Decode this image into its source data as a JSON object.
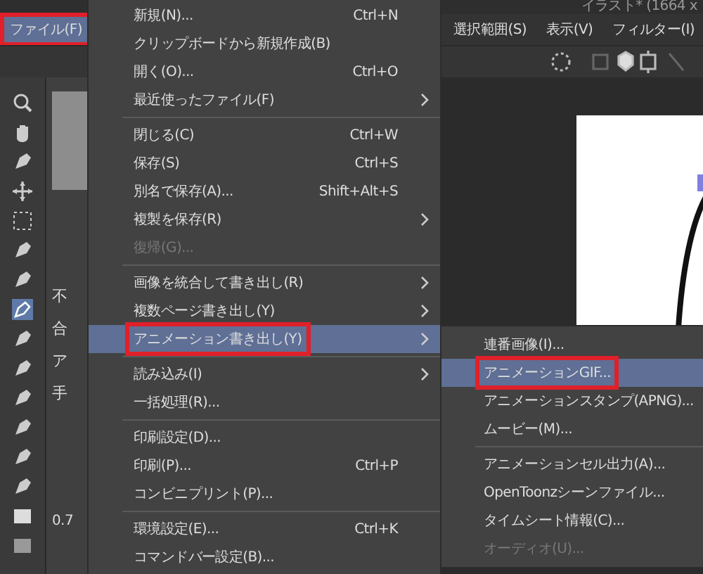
{
  "title": "イラスト* (1664 x",
  "menubar": [
    {
      "label": "ファイル(F)",
      "selected": true,
      "marked": true
    },
    {
      "label": "選択範囲(S)",
      "selected": false,
      "marked": false
    },
    {
      "label": "表示(V)",
      "selected": false,
      "marked": false
    },
    {
      "label": "フィルター(I)",
      "selected": false,
      "marked": false
    }
  ],
  "file_menu": [
    {
      "kind": "item",
      "label": "新規(N)...",
      "shortcut": "Ctrl+N",
      "submenu": false,
      "disabled": false,
      "selected": false,
      "marked": false
    },
    {
      "kind": "item",
      "label": "クリップボードから新規作成(B)",
      "submenu": false,
      "disabled": false,
      "selected": false,
      "marked": false
    },
    {
      "kind": "item",
      "label": "開く(O)...",
      "shortcut": "Ctrl+O",
      "submenu": false,
      "disabled": false,
      "selected": false,
      "marked": false
    },
    {
      "kind": "item",
      "label": "最近使ったファイル(F)",
      "submenu": true,
      "disabled": false,
      "selected": false,
      "marked": false
    },
    {
      "kind": "separator"
    },
    {
      "kind": "item",
      "label": "閉じる(C)",
      "shortcut": "Ctrl+W",
      "submenu": false,
      "disabled": false,
      "selected": false,
      "marked": false
    },
    {
      "kind": "item",
      "label": "保存(S)",
      "shortcut": "Ctrl+S",
      "submenu": false,
      "disabled": false,
      "selected": false,
      "marked": false
    },
    {
      "kind": "item",
      "label": "別名で保存(A)...",
      "shortcut": "Shift+Alt+S",
      "submenu": false,
      "disabled": false,
      "selected": false,
      "marked": false
    },
    {
      "kind": "item",
      "label": "複製を保存(R)",
      "submenu": true,
      "disabled": false,
      "selected": false,
      "marked": false
    },
    {
      "kind": "item",
      "label": "復帰(G)...",
      "submenu": false,
      "disabled": true,
      "selected": false,
      "marked": false
    },
    {
      "kind": "separator"
    },
    {
      "kind": "item",
      "label": "画像を統合して書き出し(R)",
      "submenu": true,
      "disabled": false,
      "selected": false,
      "marked": false
    },
    {
      "kind": "item",
      "label": "複数ページ書き出し(Y)",
      "submenu": true,
      "disabled": false,
      "selected": false,
      "marked": false
    },
    {
      "kind": "item",
      "label": "アニメーション書き出し(Y)",
      "submenu": true,
      "disabled": false,
      "selected": true,
      "marked": true
    },
    {
      "kind": "separator"
    },
    {
      "kind": "item",
      "label": "読み込み(I)",
      "submenu": true,
      "disabled": false,
      "selected": false,
      "marked": false
    },
    {
      "kind": "item",
      "label": "一括処理(R)...",
      "submenu": false,
      "disabled": false,
      "selected": false,
      "marked": false
    },
    {
      "kind": "separator"
    },
    {
      "kind": "item",
      "label": "印刷設定(D)...",
      "submenu": false,
      "disabled": false,
      "selected": false,
      "marked": false
    },
    {
      "kind": "item",
      "label": "印刷(P)...",
      "shortcut": "Ctrl+P",
      "submenu": false,
      "disabled": false,
      "selected": false,
      "marked": false
    },
    {
      "kind": "item",
      "label": "コンビニプリント(P)...",
      "submenu": false,
      "disabled": false,
      "selected": false,
      "marked": false
    },
    {
      "kind": "separator"
    },
    {
      "kind": "item",
      "label": "環境設定(E)...",
      "shortcut": "Ctrl+K",
      "submenu": false,
      "disabled": false,
      "selected": false,
      "marked": false
    },
    {
      "kind": "item",
      "label": "コマンドバー設定(B)...",
      "submenu": false,
      "disabled": false,
      "selected": false,
      "marked": false
    }
  ],
  "export_submenu": [
    {
      "kind": "item",
      "label": "連番画像(I)...",
      "disabled": false,
      "selected": false,
      "marked": false
    },
    {
      "kind": "item",
      "label": "アニメーションGIF...",
      "disabled": false,
      "selected": true,
      "marked": true
    },
    {
      "kind": "item",
      "label": "アニメーションスタンプ(APNG)...",
      "disabled": false,
      "selected": false,
      "marked": false
    },
    {
      "kind": "item",
      "label": "ムービー(M)...",
      "disabled": false,
      "selected": false,
      "marked": false
    },
    {
      "kind": "separator"
    },
    {
      "kind": "item",
      "label": "アニメーションセル出力(A)...",
      "disabled": false,
      "selected": false,
      "marked": false
    },
    {
      "kind": "item",
      "label": "OpenToonzシーンファイル...",
      "disabled": false,
      "selected": false,
      "marked": false
    },
    {
      "kind": "item",
      "label": "タイムシート情報(C)...",
      "disabled": false,
      "selected": false,
      "marked": false
    },
    {
      "kind": "item",
      "label": "オーディオ(U)...",
      "disabled": true,
      "selected": false,
      "marked": false
    }
  ],
  "tool_property": {
    "labels": [
      "不",
      "合",
      "ア",
      "手"
    ],
    "value": "0.7"
  }
}
